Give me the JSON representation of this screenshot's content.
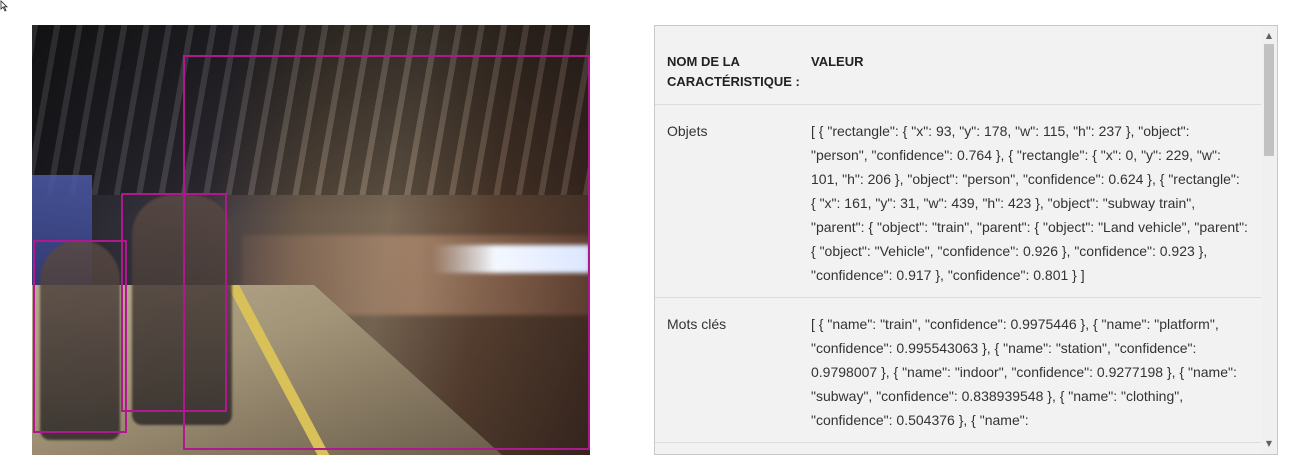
{
  "table": {
    "header": {
      "name": "NOM DE LA CARACTÉRISTIQUE :",
      "value": "VALEUR"
    },
    "rows": [
      {
        "name": "Objets",
        "value": "[ { \"rectangle\": { \"x\": 93, \"y\": 178, \"w\": 115, \"h\": 237 }, \"object\": \"person\", \"confidence\": 0.764 }, { \"rectangle\": { \"x\": 0, \"y\": 229, \"w\": 101, \"h\": 206 }, \"object\": \"person\", \"confidence\": 0.624 }, { \"rectangle\": { \"x\": 161, \"y\": 31, \"w\": 439, \"h\": 423 }, \"object\": \"subway train\", \"parent\": { \"object\": \"train\", \"parent\": { \"object\": \"Land vehicle\", \"parent\": { \"object\": \"Vehicle\", \"confidence\": 0.926 }, \"confidence\": 0.923 }, \"confidence\": 0.917 }, \"confidence\": 0.801 } ]"
      },
      {
        "name": "Mots clés",
        "value": "[ { \"name\": \"train\", \"confidence\": 0.9975446 }, { \"name\": \"platform\", \"confidence\": 0.995543063 }, { \"name\": \"station\", \"confidence\": 0.9798007 }, { \"name\": \"indoor\", \"confidence\": 0.9277198 }, { \"name\": \"subway\", \"confidence\": 0.838939548 }, { \"name\": \"clothing\", \"confidence\": 0.504376 }, { \"name\":"
      }
    ]
  },
  "colors": {
    "bbox": "#b0188f",
    "panel_bg": "#f2f2f2"
  },
  "icons": {
    "scroll_up": "triangle-up-icon",
    "scroll_down": "triangle-down-icon",
    "cursor": "mouse-pointer-icon"
  }
}
